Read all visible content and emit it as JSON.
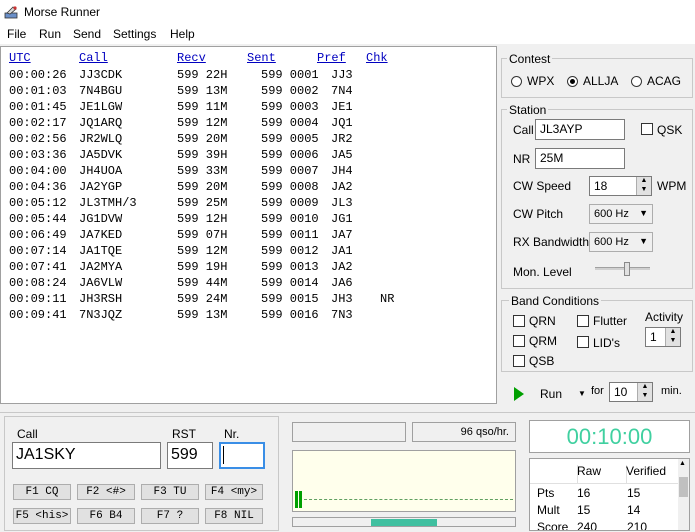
{
  "window": {
    "title": "Morse Runner"
  },
  "menu": [
    "File",
    "Run",
    "Send",
    "Settings",
    "Help"
  ],
  "log": {
    "columns": [
      "UTC",
      "Call",
      "Recv",
      "Sent",
      "Pref",
      "Chk"
    ],
    "rows": [
      {
        "utc": "00:00:26",
        "call": "JJ3CDK",
        "recv": "599 22H",
        "sent": "599 0001",
        "pref": "JJ3",
        "chk": ""
      },
      {
        "utc": "00:01:03",
        "call": "7N4BGU",
        "recv": "599 13M",
        "sent": "599 0002",
        "pref": "7N4",
        "chk": ""
      },
      {
        "utc": "00:01:45",
        "call": "JE1LGW",
        "recv": "599 11M",
        "sent": "599 0003",
        "pref": "JE1",
        "chk": ""
      },
      {
        "utc": "00:02:17",
        "call": "JQ1ARQ",
        "recv": "599 12M",
        "sent": "599 0004",
        "pref": "JQ1",
        "chk": ""
      },
      {
        "utc": "00:02:56",
        "call": "JR2WLQ",
        "recv": "599 20M",
        "sent": "599 0005",
        "pref": "JR2",
        "chk": ""
      },
      {
        "utc": "00:03:36",
        "call": "JA5DVK",
        "recv": "599 39H",
        "sent": "599 0006",
        "pref": "JA5",
        "chk": ""
      },
      {
        "utc": "00:04:00",
        "call": "JH4UOA",
        "recv": "599 33M",
        "sent": "599 0007",
        "pref": "JH4",
        "chk": ""
      },
      {
        "utc": "00:04:36",
        "call": "JA2YGP",
        "recv": "599 20M",
        "sent": "599 0008",
        "pref": "JA2",
        "chk": ""
      },
      {
        "utc": "00:05:12",
        "call": "JL3TMH/3",
        "recv": "599 25M",
        "sent": "599 0009",
        "pref": "JL3",
        "chk": ""
      },
      {
        "utc": "00:05:44",
        "call": "JG1DVW",
        "recv": "599 12H",
        "sent": "599 0010",
        "pref": "JG1",
        "chk": ""
      },
      {
        "utc": "00:06:49",
        "call": "JA7KED",
        "recv": "599 07H",
        "sent": "599 0011",
        "pref": "JA7",
        "chk": ""
      },
      {
        "utc": "00:07:14",
        "call": "JA1TQE",
        "recv": "599 12M",
        "sent": "599 0012",
        "pref": "JA1",
        "chk": ""
      },
      {
        "utc": "00:07:41",
        "call": "JA2MYA",
        "recv": "599 19H",
        "sent": "599 0013",
        "pref": "JA2",
        "chk": ""
      },
      {
        "utc": "00:08:24",
        "call": "JA6VLW",
        "recv": "599 44M",
        "sent": "599 0014",
        "pref": "JA6",
        "chk": ""
      },
      {
        "utc": "00:09:11",
        "call": "JH3RSH",
        "recv": "599 24M",
        "sent": "599 0015",
        "pref": "JH3",
        "chk": "NR"
      },
      {
        "utc": "00:09:41",
        "call": "7N3JQZ",
        "recv": "599 13M",
        "sent": "599 0016",
        "pref": "7N3",
        "chk": ""
      }
    ]
  },
  "contest": {
    "label": "Contest",
    "options": [
      "WPX",
      "ALLJA",
      "ACAG"
    ],
    "selected": "ALLJA"
  },
  "station": {
    "label": "Station",
    "call_label": "Call",
    "call": "JL3AYP",
    "qsk_label": "QSK",
    "nr_label": "NR",
    "nr": "25M",
    "cw_speed_label": "CW Speed",
    "cw_speed": "18",
    "wpm_label": "WPM",
    "cw_pitch_label": "CW Pitch",
    "cw_pitch": "600 Hz",
    "rx_bw_label": "RX Bandwidth",
    "rx_bw": "600 Hz",
    "mon_level_label": "Mon. Level",
    "mon_level": 0.6
  },
  "band": {
    "label": "Band Conditions",
    "checks": [
      "QRN",
      "Flutter",
      "QRM",
      "LID's",
      "QSB"
    ],
    "activity_label": "Activity",
    "activity": "1"
  },
  "run": {
    "label": "Run",
    "for_label": "for",
    "minutes": "10",
    "min_label": "min."
  },
  "entry": {
    "call_label": "Call",
    "call": "JA1SKY",
    "rst_label": "RST",
    "rst": "599",
    "nr_label": "Nr.",
    "nr": ""
  },
  "fkeys": [
    "F1 CQ",
    "F2 <#>",
    "F3 TU",
    "F4 <my>",
    "F5 <his>",
    "F6 B4",
    "F7 ?",
    "F8 NIL"
  ],
  "rate": {
    "text": "96 qso/hr."
  },
  "timer": "00:10:00",
  "score": {
    "headers": [
      "",
      "Raw",
      "Verified"
    ],
    "rows": [
      [
        "Pts",
        "16",
        "15"
      ],
      [
        "Mult",
        "15",
        "14"
      ],
      [
        "Score",
        "240",
        "210"
      ]
    ]
  },
  "colors": {
    "timer": "#40d0a0",
    "timer_bg": "#ffffff",
    "scope_bg": "#ffffec",
    "log_header": "#0000c0",
    "play": "#00a000"
  }
}
